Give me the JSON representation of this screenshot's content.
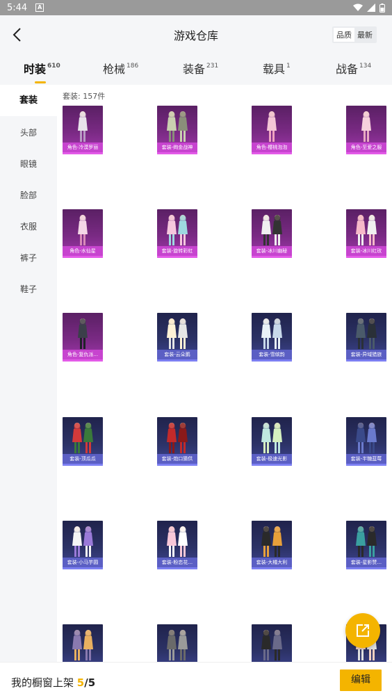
{
  "status_bar": {
    "time": "5:44",
    "notif_icon": "a-icon",
    "icons": [
      "wifi-icon",
      "signal-icon",
      "battery-icon"
    ]
  },
  "header": {
    "title": "游戏仓库",
    "sort_options": [
      "品质",
      "最新"
    ],
    "sort_selected": "品质"
  },
  "tabs": [
    {
      "label": "时装",
      "count": "610",
      "active": true
    },
    {
      "label": "枪械",
      "count": "186",
      "active": false
    },
    {
      "label": "装备",
      "count": "231",
      "active": false
    },
    {
      "label": "载具",
      "count": "1",
      "active": false
    },
    {
      "label": "战备",
      "count": "134",
      "active": false
    }
  ],
  "sidebar": {
    "items": [
      "套装",
      "头部",
      "眼镜",
      "脸部",
      "衣服",
      "裤子",
      "鞋子"
    ],
    "active": "套装"
  },
  "content": {
    "count_label": "套装: 157件",
    "items": [
      {
        "name": "角色-冷漠罗丽",
        "tier": "purple"
      },
      {
        "name": "套装-绚金战神",
        "tier": "purple"
      },
      {
        "name": "角色-樱桃泡泡",
        "tier": "purple"
      },
      {
        "name": "角色-至爱之服",
        "tier": "purple"
      },
      {
        "name": "角色-水仙星",
        "tier": "purple"
      },
      {
        "name": "套装-旋转彩虹",
        "tier": "purple"
      },
      {
        "name": "套装-冰川幽秘",
        "tier": "purple"
      },
      {
        "name": "套装-冰川红玫",
        "tier": "purple"
      },
      {
        "name": "角色-复仇派...",
        "tier": "purple"
      },
      {
        "name": "套装-云朵鹅",
        "tier": "blue"
      },
      {
        "name": "套装-雪缤韵",
        "tier": "blue"
      },
      {
        "name": "套装-异域猎旅",
        "tier": "blue"
      },
      {
        "name": "套装-顶瓜瓜",
        "tier": "blue"
      },
      {
        "name": "套装-炮口猜供",
        "tier": "blue"
      },
      {
        "name": "套装-极速光影",
        "tier": "blue"
      },
      {
        "name": "套装-半糖蓝莓",
        "tier": "blue"
      },
      {
        "name": "套装-小马芋圆",
        "tier": "blue"
      },
      {
        "name": "套装-粉恋花...",
        "tier": "blue"
      },
      {
        "name": "套装-大橘大利",
        "tier": "blue"
      },
      {
        "name": "套装-星影赞...",
        "tier": "blue"
      },
      {
        "name": "",
        "tier": "blue"
      },
      {
        "name": "",
        "tier": "blue"
      },
      {
        "name": "",
        "tier": "blue"
      },
      {
        "name": "",
        "tier": "blue"
      }
    ]
  },
  "float_button": {
    "icon": "share-icon"
  },
  "footer": {
    "label": "我的橱窗上架",
    "current": "5",
    "separator": "/",
    "total": "5",
    "edit_label": "编辑"
  },
  "colors": {
    "accent": "#f4b400",
    "purple_tier": "#c744cf",
    "blue_tier": "#5b5fc4",
    "panel_bg": "#f5f6f8"
  }
}
